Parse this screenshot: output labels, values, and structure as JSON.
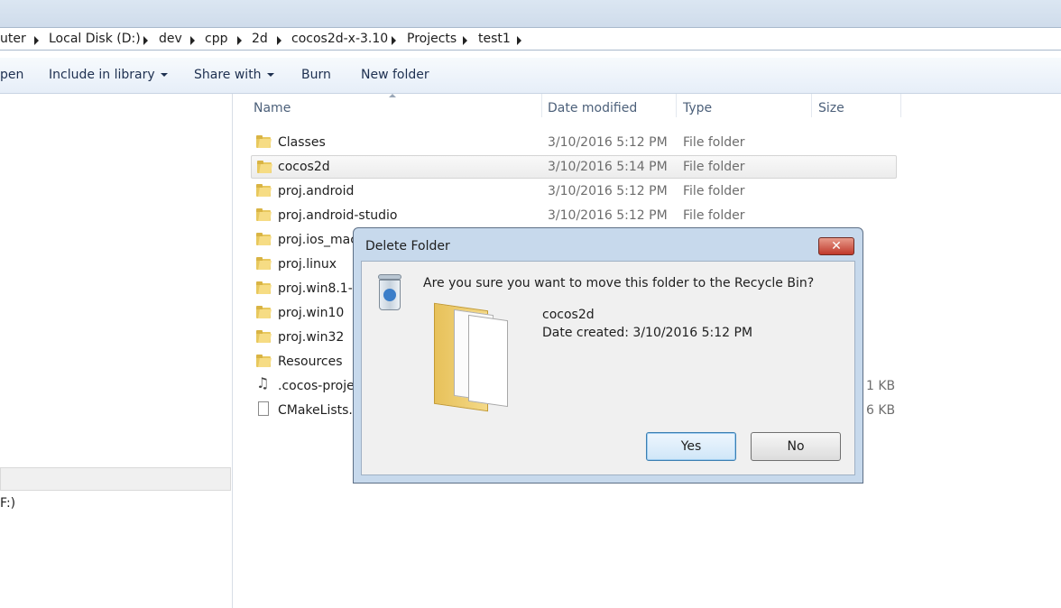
{
  "breadcrumb": [
    "uter",
    "Local Disk (D:)",
    "dev",
    "cpp",
    "2d",
    "cocos2d-x-3.10",
    "Projects",
    "test1"
  ],
  "toolbar": {
    "open_label": "pen",
    "include_label": "Include in library",
    "share_label": "Share with",
    "burn_label": "Burn",
    "new_folder_label": "New folder"
  },
  "nav": {
    "drive_label": "F:)"
  },
  "columns": {
    "name": "Name",
    "date": "Date modified",
    "type": "Type",
    "size": "Size"
  },
  "files": [
    {
      "name": "Classes",
      "date": "3/10/2016 5:12 PM",
      "type": "File folder",
      "size": ""
    },
    {
      "name": "cocos2d",
      "date": "3/10/2016 5:14 PM",
      "type": "File folder",
      "size": ""
    },
    {
      "name": "proj.android",
      "date": "3/10/2016 5:12 PM",
      "type": "File folder",
      "size": ""
    },
    {
      "name": "proj.android-studio",
      "date": "3/10/2016 5:12 PM",
      "type": "File folder",
      "size": ""
    },
    {
      "name": "proj.ios_mac",
      "date": "",
      "type": "",
      "size": ""
    },
    {
      "name": "proj.linux",
      "date": "",
      "type": "",
      "size": ""
    },
    {
      "name": "proj.win8.1-u",
      "date": "",
      "type": "",
      "size": ""
    },
    {
      "name": "proj.win10",
      "date": "",
      "type": "",
      "size": ""
    },
    {
      "name": "proj.win32",
      "date": "",
      "type": "",
      "size": ""
    },
    {
      "name": "Resources",
      "date": "",
      "type": "",
      "size": ""
    },
    {
      "name": ".cocos-proje",
      "date": "",
      "type": "",
      "size": "1 KB"
    },
    {
      "name": "CMakeLists.t",
      "date": "",
      "type": "",
      "size": "6 KB"
    }
  ],
  "dialog": {
    "title": "Delete Folder",
    "close_glyph": "✕",
    "question": "Are you sure you want to move this folder to the Recycle Bin?",
    "folder_name": "cocos2d",
    "date_created": "Date created: 3/10/2016 5:12 PM",
    "yes_label": "Yes",
    "no_label": "No"
  },
  "icons": {
    "breadcrumb_separator": "chevron-right-icon",
    "file_folder": "folder-icon",
    "cocos_project": "music-note-icon",
    "text_file": "text-file-icon",
    "dialog_icon": "recycle-bin-icon"
  }
}
